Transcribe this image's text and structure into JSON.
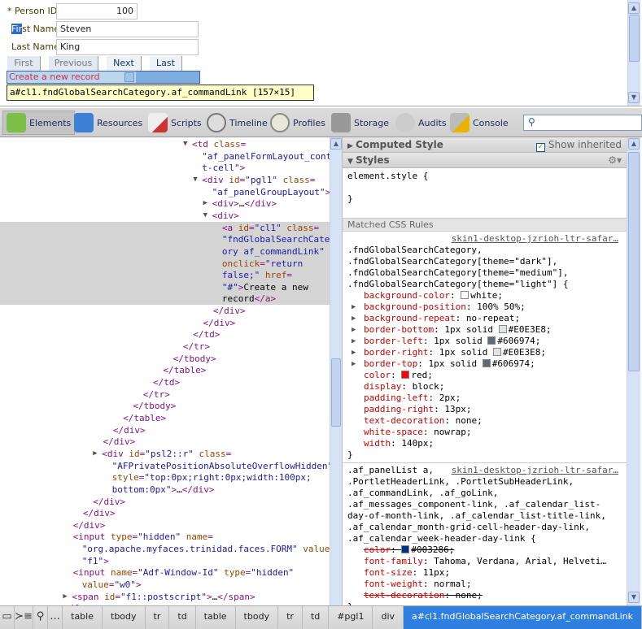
{
  "form": {
    "person_id_label": "* Person ID",
    "person_id": "100",
    "first_name_label": "First Name",
    "first_name": "Steven",
    "last_name_label": "Last Name",
    "last_name": "King",
    "nav": [
      "First",
      "Previous",
      "Next",
      "Last"
    ],
    "create_link": "Create a new record",
    "tooltip": "a#cl1.fndGlobalSearchCategory.af_commandLink [157×15]"
  },
  "toolbar": {
    "tabs": [
      {
        "label": "Elements",
        "icon": "elements-icon",
        "color": "#7cc04a"
      },
      {
        "label": "Resources",
        "icon": "resources-icon",
        "color": "#3b7fd6"
      },
      {
        "label": "Scripts",
        "icon": "scripts-icon",
        "color": "#c33"
      },
      {
        "label": "Timeline",
        "icon": "timeline-icon",
        "color": "#d33"
      },
      {
        "label": "Profiles",
        "icon": "profiles-icon",
        "color": "#aaa"
      },
      {
        "label": "Storage",
        "icon": "storage-icon",
        "color": "#888"
      },
      {
        "label": "Audits",
        "icon": "audits-icon",
        "color": "#999"
      },
      {
        "label": "Console",
        "icon": "console-icon",
        "color": "#e8b400"
      }
    ],
    "search_placeholder": ""
  },
  "tree": [
    {
      "d": 0,
      "tri": "▼",
      "s": [
        [
          "tag",
          "<td "
        ],
        [
          "an",
          "class"
        ],
        [
          "tag",
          "="
        ]
      ]
    },
    {
      "d": 1,
      "s": [
        [
          "av",
          "\"af_panelFormLayout_conten"
        ]
      ]
    },
    {
      "d": 1,
      "s": [
        [
          "av",
          "t-cell\""
        ],
        [
          "tag",
          ">"
        ]
      ]
    },
    {
      "d": 1,
      "tri": "▼",
      "s": [
        [
          "tag",
          "<div "
        ],
        [
          "an",
          "id"
        ],
        [
          "tag",
          "="
        ],
        [
          "av",
          "\"pgl1\" "
        ],
        [
          "an",
          "class"
        ],
        [
          "tag",
          "="
        ]
      ]
    },
    {
      "d": 2,
      "s": [
        [
          "av",
          "\"af_panelGroupLayout\""
        ],
        [
          "tag",
          ">"
        ]
      ]
    },
    {
      "d": 2,
      "tri": "▶",
      "s": [
        [
          "tag",
          "<div>"
        ],
        [
          "tx",
          "…"
        ],
        [
          "tag",
          "</div>"
        ]
      ]
    },
    {
      "d": 2,
      "tri": "▼",
      "s": [
        [
          "tag",
          "<div>"
        ]
      ]
    },
    {
      "d": 3,
      "sel": true,
      "s": [
        [
          "tag",
          "<a "
        ],
        [
          "an",
          "id"
        ],
        [
          "tag",
          "="
        ],
        [
          "av",
          "\"cl1\" "
        ],
        [
          "an",
          "class"
        ],
        [
          "tag",
          "="
        ]
      ]
    },
    {
      "d": 3,
      "sel": true,
      "s": [
        [
          "av",
          "\"fndGlobalSearchCateg"
        ]
      ]
    },
    {
      "d": 3,
      "sel": true,
      "s": [
        [
          "av",
          "ory af_commandLink\""
        ]
      ]
    },
    {
      "d": 3,
      "sel": true,
      "s": [
        [
          "an",
          "onclick"
        ],
        [
          "tag",
          "="
        ],
        [
          "av",
          "\"return"
        ]
      ]
    },
    {
      "d": 3,
      "sel": true,
      "s": [
        [
          "av",
          "false;\" "
        ],
        [
          "an",
          "href"
        ],
        [
          "tag",
          "="
        ]
      ]
    },
    {
      "d": 3,
      "sel": true,
      "s": [
        [
          "av",
          "\"#\""
        ],
        [
          "tag",
          ">"
        ],
        [
          "tx",
          "Create a new"
        ]
      ]
    },
    {
      "d": 3,
      "sel": true,
      "s": [
        [
          "tx",
          "record"
        ],
        [
          "tag",
          "</a>"
        ]
      ]
    },
    {
      "d": 2.1,
      "s": [
        [
          "tag",
          "</div>"
        ]
      ]
    },
    {
      "d": 1.1,
      "s": [
        [
          "tag",
          "</div>"
        ]
      ]
    },
    {
      "d": 0.1,
      "s": [
        [
          "tag",
          "</td>"
        ]
      ]
    },
    {
      "d": -0.9,
      "s": [
        [
          "tag",
          "</tr>"
        ]
      ]
    },
    {
      "d": -1.9,
      "s": [
        [
          "tag",
          "</tbody>"
        ]
      ]
    },
    {
      "d": -2.9,
      "s": [
        [
          "tag",
          "</table>"
        ]
      ]
    },
    {
      "d": -3.9,
      "s": [
        [
          "tag",
          "</td>"
        ]
      ]
    },
    {
      "d": -4.9,
      "s": [
        [
          "tag",
          "</tr>"
        ]
      ]
    },
    {
      "d": -5.9,
      "s": [
        [
          "tag",
          "</tbody>"
        ]
      ]
    },
    {
      "d": -6.9,
      "s": [
        [
          "tag",
          "</table>"
        ]
      ]
    },
    {
      "d": -7.9,
      "s": [
        [
          "tag",
          "</div>"
        ]
      ]
    },
    {
      "d": -8.9,
      "s": [
        [
          "tag",
          "</div>"
        ]
      ]
    },
    {
      "d": -9,
      "tri": "▶",
      "s": [
        [
          "tag",
          "<div "
        ],
        [
          "an",
          "id"
        ],
        [
          "tag",
          "="
        ],
        [
          "av",
          "\"psl2::r\" "
        ],
        [
          "an",
          "class"
        ],
        [
          "tag",
          "="
        ]
      ]
    },
    {
      "d": -8,
      "s": [
        [
          "av",
          "\"AFPrivatePositionAbsoluteOverflowHidden\""
        ]
      ]
    },
    {
      "d": -8,
      "s": [
        [
          "an",
          "style"
        ],
        [
          "tag",
          "="
        ],
        [
          "av",
          "\"top:0px;right:0px;width:100px;"
        ]
      ]
    },
    {
      "d": -8,
      "s": [
        [
          "av",
          "bottom:0px\""
        ],
        [
          "tag",
          ">"
        ],
        [
          "tx",
          "…"
        ],
        [
          "tag",
          "</div>"
        ]
      ]
    },
    {
      "d": -9.9,
      "s": [
        [
          "tag",
          "</div>"
        ]
      ]
    },
    {
      "d": -10.9,
      "s": [
        [
          "tag",
          "</div>"
        ]
      ]
    },
    {
      "d": -11.9,
      "s": [
        [
          "tag",
          "</div>"
        ]
      ]
    },
    {
      "d": -11.9,
      "s": [
        [
          "tag",
          "<input "
        ],
        [
          "an",
          "type"
        ],
        [
          "tag",
          "="
        ],
        [
          "av",
          "\"hidden\" "
        ],
        [
          "an",
          "name"
        ],
        [
          "tag",
          "="
        ]
      ]
    },
    {
      "d": -11,
      "s": [
        [
          "av",
          "\"org.apache.myfaces.trinidad.faces.FORM\" "
        ],
        [
          "an",
          "value"
        ],
        [
          "tag",
          "="
        ]
      ]
    },
    {
      "d": -11,
      "s": [
        [
          "av",
          "\"f1\""
        ],
        [
          "tag",
          ">"
        ]
      ]
    },
    {
      "d": -11.9,
      "s": [
        [
          "tag",
          "<input "
        ],
        [
          "an",
          "name"
        ],
        [
          "tag",
          "="
        ],
        [
          "av",
          "\"Adf-Window-Id\" "
        ],
        [
          "an",
          "type"
        ],
        [
          "tag",
          "="
        ],
        [
          "av",
          "\"hidden\""
        ]
      ]
    },
    {
      "d": -11,
      "s": [
        [
          "an",
          "value"
        ],
        [
          "tag",
          "="
        ],
        [
          "av",
          "\"w0\""
        ],
        [
          "tag",
          ">"
        ]
      ]
    },
    {
      "d": -12,
      "tri": "▶",
      "s": [
        [
          "tag",
          "<span "
        ],
        [
          "an",
          "id"
        ],
        [
          "tag",
          "="
        ],
        [
          "av",
          "\"f1::postscript\""
        ],
        [
          "tag",
          ">"
        ],
        [
          "tx",
          "…"
        ],
        [
          "tag",
          "</span>"
        ]
      ]
    },
    {
      "d": -12.9,
      "s": [
        [
          "tag",
          "</form>"
        ]
      ]
    }
  ],
  "styles": {
    "computed_title": "Computed Style",
    "show_inherited": "Show inherited",
    "styles_title": "Styles",
    "element_style_open": "element.style {",
    "close": "}",
    "matched_title": "Matched CSS Rules",
    "rule1": {
      "source": "skin1-desktop-jzrioh-ltr-safar…",
      "selectors": [
        ".fndGlobalSearchCategory,",
        ".fndGlobalSearchCategory[theme=\"dark\"],",
        ".fndGlobalSearchCategory[theme=\"medium\"],",
        ".fndGlobalSearchCategory[theme=\"light\"] {"
      ],
      "props": [
        {
          "n": "background-color",
          "v": "white;",
          "sw": "#ffffff"
        },
        {
          "n": "background-position",
          "v": "100% 50%;",
          "exp": true
        },
        {
          "n": "background-repeat",
          "v": "no-repeat;",
          "exp": true
        },
        {
          "n": "border-bottom",
          "v": "1px solid ",
          "sw": "#E0E3E8",
          "v2": "#E0E3E8;",
          "exp": true
        },
        {
          "n": "border-left",
          "v": "1px solid ",
          "sw": "#606974",
          "v2": "#606974;",
          "exp": true
        },
        {
          "n": "border-right",
          "v": "1px solid ",
          "sw": "#E0E3E8",
          "v2": "#E0E3E8;",
          "exp": true
        },
        {
          "n": "border-top",
          "v": "1px solid ",
          "sw": "#606974",
          "v2": "#606974;",
          "exp": true
        },
        {
          "n": "color",
          "v": "",
          "sw": "#ff0000",
          "v2": "red;"
        },
        {
          "n": "display",
          "v": "block;"
        },
        {
          "n": "padding-left",
          "v": "2px;"
        },
        {
          "n": "padding-right",
          "v": "13px;"
        },
        {
          "n": "text-decoration",
          "v": "none;"
        },
        {
          "n": "white-space",
          "v": "nowrap;"
        },
        {
          "n": "width",
          "v": "140px;"
        }
      ]
    },
    "rule2": {
      "source": "skin1-desktop-jzrioh-ltr-safar…",
      "first": ".af_panelList a,",
      "selectors": [
        ".PortletHeaderLink, .PortletSubHeaderLink,",
        ".af_commandLink, .af_goLink,",
        ".af_messages_component-link, .af_calendar_list-",
        "day-of-month-link, .af_calendar_list-title-link,",
        ".af_calendar_month-grid-cell-header-day-link,",
        ".af_calendar_week-header-day-link {"
      ],
      "props": [
        {
          "n": "color",
          "v": "",
          "sw": "#003286",
          "v2": "#003286;",
          "strike": true
        },
        {
          "n": "font-family",
          "v": "Tahoma, Verdana, Arial, Helveti…"
        },
        {
          "n": "font-size",
          "v": "11px;"
        },
        {
          "n": "font-weight",
          "v": "normal;"
        },
        {
          "n": "text-decoration",
          "v": "none;",
          "strike": true
        }
      ]
    }
  },
  "breadcrumbs": [
    "table",
    "tbody",
    "tr",
    "td",
    "table",
    "tbody",
    "tr",
    "td",
    "#pgl1",
    "div",
    "a#cl1.fndGlobalSearchCategory.af_commandLink"
  ],
  "bottom_icons": [
    "dock-icon",
    "console-toggle-icon",
    "search-icon",
    "more-icon"
  ],
  "ellipsis": "..."
}
